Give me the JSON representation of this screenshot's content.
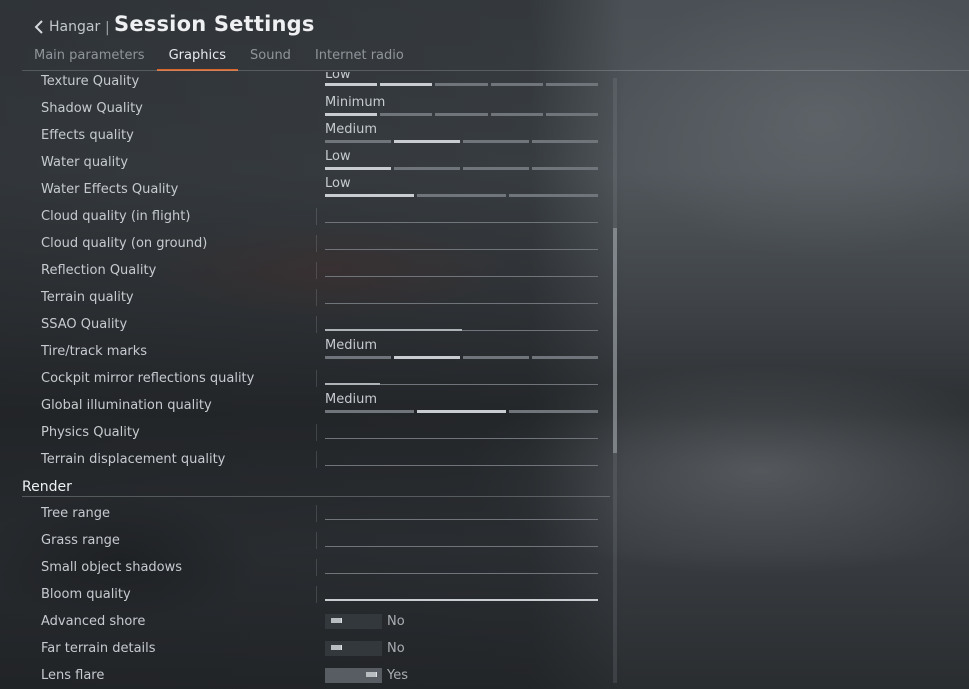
{
  "header": {
    "back_label": "Hangar",
    "separator": "|",
    "title": "Session Settings"
  },
  "tabs": [
    {
      "label": "Main parameters"
    },
    {
      "label": "Graphics"
    },
    {
      "label": "Sound"
    },
    {
      "label": "Internet radio"
    }
  ],
  "active_tab": "Graphics",
  "accent_color": "#d8672d",
  "graphics_rows": [
    {
      "label": "Texture Quality",
      "value": "Low",
      "level": "2 of 5"
    },
    {
      "label": "Shadow Quality",
      "value": "Minimum",
      "level": "1 of 5"
    },
    {
      "label": "Effects quality",
      "value": "Medium",
      "level": "2nd segment of 4"
    },
    {
      "label": "Water quality",
      "value": "Low",
      "level": "1 of 4"
    },
    {
      "label": "Water Effects Quality",
      "value": "Low",
      "level": "1 of 3"
    },
    {
      "label": "Cloud quality (in flight)",
      "value": "",
      "level": "0%"
    },
    {
      "label": "Cloud quality (on ground)",
      "value": "",
      "level": "0%"
    },
    {
      "label": "Reflection Quality",
      "value": "",
      "level": "0%"
    },
    {
      "label": "Terrain quality",
      "value": "",
      "level": "0%"
    },
    {
      "label": "SSAO Quality",
      "value": "",
      "level": "50%"
    },
    {
      "label": "Tire/track marks",
      "value": "Medium",
      "level": "2nd segment of 4"
    },
    {
      "label": "Cockpit mirror reflections quality",
      "value": "",
      "level": "20%"
    },
    {
      "label": "Global illumination quality",
      "value": "Medium",
      "level": "2nd segment of 3"
    },
    {
      "label": "Physics Quality",
      "value": "",
      "level": "0%"
    },
    {
      "label": "Terrain displacement quality",
      "value": "",
      "level": "0%"
    }
  ],
  "render_section": {
    "title": "Render",
    "rows": [
      {
        "label": "Tree range",
        "level": "0%"
      },
      {
        "label": "Grass range",
        "level": "0%"
      },
      {
        "label": "Small object shadows",
        "level": "0%"
      },
      {
        "label": "Bloom quality",
        "level": "100%"
      }
    ],
    "toggles": [
      {
        "label": "Advanced shore",
        "state_label": "No",
        "on": false
      },
      {
        "label": "Far terrain details",
        "state_label": "No",
        "on": false
      },
      {
        "label": "Lens flare",
        "state_label": "Yes",
        "on": true
      }
    ]
  }
}
